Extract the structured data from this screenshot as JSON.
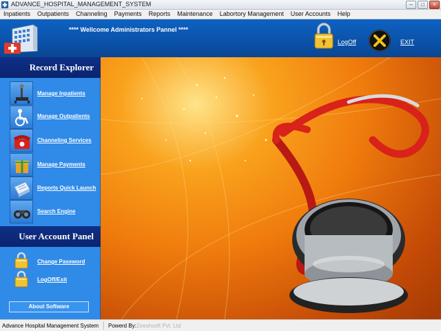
{
  "window": {
    "title": "ADVANCE_HOSPITAL_MANAGEMENT_SYSTEM",
    "min": "–",
    "max": "□",
    "close": "×"
  },
  "menu": [
    "Inpatients",
    "Outpatients",
    "Channeling",
    "Payments",
    "Reports",
    "Maintenance",
    "Labortory Management",
    "User Accounts",
    "Help"
  ],
  "header": {
    "welcome": "**** Wellcome Administrators Pannel ****",
    "logoff": "LogOff",
    "exit": "EXIT"
  },
  "record_explorer": {
    "title": "Record Explorer",
    "items": [
      {
        "label": "Manage Inpatients",
        "icon": "inpatient-icon"
      },
      {
        "label": "Manage Outpatients",
        "icon": "wheelchair-icon"
      },
      {
        "label": "Channeling Services",
        "icon": "telephone-icon"
      },
      {
        "label": "Manage Payments",
        "icon": "gift-box-icon"
      },
      {
        "label": "Reports Quick Launch",
        "icon": "report-icon"
      },
      {
        "label": "Search Engine",
        "icon": "binoculars-icon"
      }
    ]
  },
  "user_account_panel": {
    "title": "User Account Panel",
    "items": [
      {
        "label": "Change Password",
        "icon": "padlock-icon"
      },
      {
        "label": "LogOff/Exit",
        "icon": "padlock-icon"
      }
    ]
  },
  "about_button": "About Software",
  "status": {
    "app": "Advance Hospital Management System",
    "powered": "Powerd By:",
    "company": "Zeeshsoft Pvt. Ltd"
  },
  "colors": {
    "header_blue": "#0a4fa4",
    "sidebar_blue": "#2f8ae8",
    "panel_navy": "#0a2470",
    "main_orange": "#f07c0d",
    "stethoscope_red": "#d8221a"
  }
}
